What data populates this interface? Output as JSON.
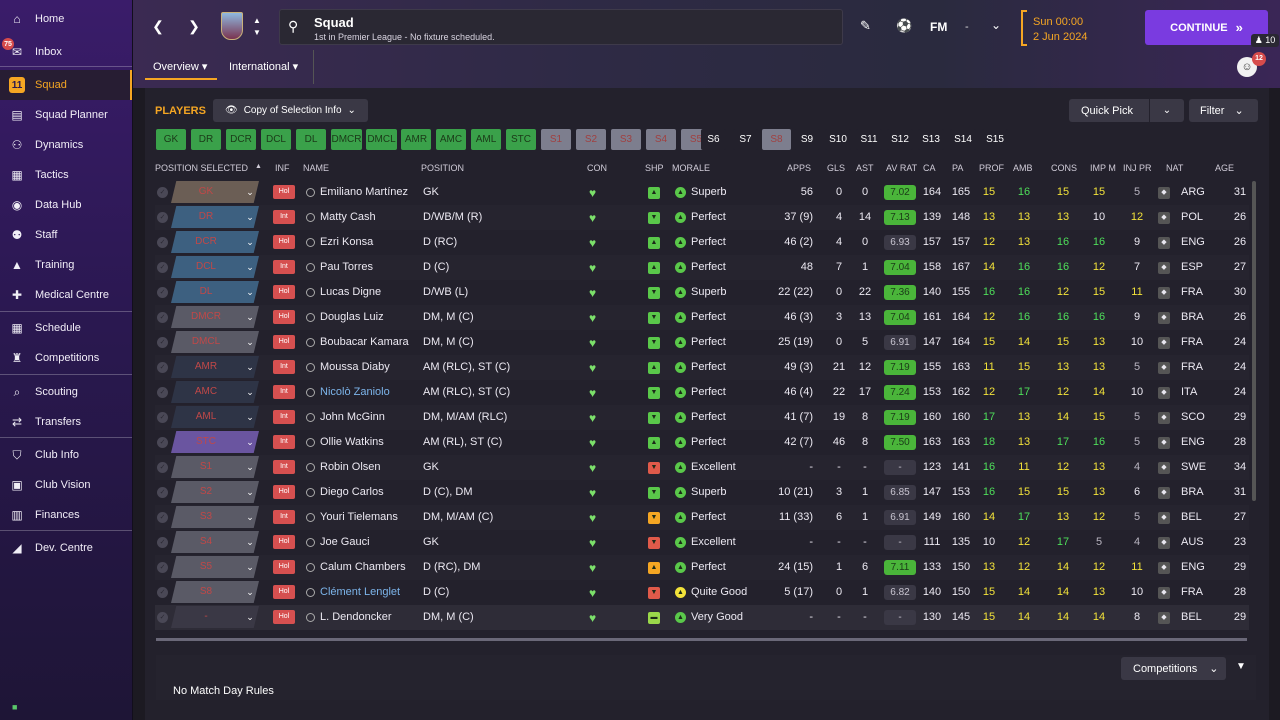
{
  "sidebar": {
    "inbox_badge": "75",
    "items": [
      {
        "label": "Home",
        "icon": "home-icon",
        "glyph": "⌂"
      },
      {
        "label": "Inbox",
        "icon": "inbox-icon",
        "glyph": "✉"
      },
      {
        "label": "Squad",
        "icon": "squad-icon",
        "glyph": "11"
      },
      {
        "label": "Squad Planner",
        "icon": "squad-planner-icon",
        "glyph": "▤"
      },
      {
        "label": "Dynamics",
        "icon": "dynamics-icon",
        "glyph": "⚇"
      },
      {
        "label": "Tactics",
        "icon": "tactics-icon",
        "glyph": "▦"
      },
      {
        "label": "Data Hub",
        "icon": "data-hub-icon",
        "glyph": "◉"
      },
      {
        "label": "Staff",
        "icon": "staff-icon",
        "glyph": "⚉"
      },
      {
        "label": "Training",
        "icon": "training-icon",
        "glyph": "▲"
      },
      {
        "label": "Medical Centre",
        "icon": "medical-icon",
        "glyph": "✚"
      },
      {
        "label": "Schedule",
        "icon": "schedule-icon",
        "glyph": "▦"
      },
      {
        "label": "Competitions",
        "icon": "trophy-icon",
        "glyph": "♜"
      },
      {
        "label": "Scouting",
        "icon": "scouting-icon",
        "glyph": "⌕"
      },
      {
        "label": "Transfers",
        "icon": "transfers-icon",
        "glyph": "⇄"
      },
      {
        "label": "Club Info",
        "icon": "club-info-icon",
        "glyph": "⛉"
      },
      {
        "label": "Club Vision",
        "icon": "club-vision-icon",
        "glyph": "▣"
      },
      {
        "label": "Finances",
        "icon": "finances-icon",
        "glyph": "▥"
      },
      {
        "label": "Dev. Centre",
        "icon": "dev-centre-icon",
        "glyph": "◢"
      }
    ]
  },
  "header": {
    "title": "Squad",
    "subtitle": "1st in Premier League - No fixture scheduled.",
    "fm_label": "FM",
    "fm_dash": "-",
    "date_line1": "Sun 00:00",
    "date_line2": "2 Jun 2024",
    "continue_label": "CONTINUE",
    "inbox_count": "10",
    "notifications": "12",
    "tabs": [
      {
        "label": "Overview ▾"
      },
      {
        "label": "International ▾"
      }
    ]
  },
  "panel": {
    "players_label": "PLAYERS",
    "selection_info": "Copy of Selection Info",
    "quick_pick": "Quick Pick",
    "filter": "Filter",
    "competitions": "Competitions",
    "no_match_rules": "No Match Day Rules"
  },
  "position_chips": [
    {
      "label": "GK",
      "style": "green"
    },
    {
      "label": "DR",
      "style": "green"
    },
    {
      "label": "DCR",
      "style": "green"
    },
    {
      "label": "DCL",
      "style": "green"
    },
    {
      "label": "DL",
      "style": "green"
    },
    {
      "label": "DMCR",
      "style": "green"
    },
    {
      "label": "DMCL",
      "style": "green"
    },
    {
      "label": "AMR",
      "style": "green"
    },
    {
      "label": "AMC",
      "style": "green"
    },
    {
      "label": "AML",
      "style": "green"
    },
    {
      "label": "STC",
      "style": "green"
    },
    {
      "label": "S1",
      "style": "gray"
    },
    {
      "label": "S2",
      "style": "gray"
    },
    {
      "label": "S3",
      "style": "gray"
    },
    {
      "label": "S4",
      "style": "gray"
    },
    {
      "label": "S5",
      "style": "gray"
    },
    {
      "label": "S6",
      "style": "dark"
    },
    {
      "label": "S7",
      "style": "dark"
    },
    {
      "label": "S8",
      "style": "gray"
    },
    {
      "label": "S9",
      "style": "dark"
    },
    {
      "label": "S10",
      "style": "dark"
    },
    {
      "label": "S11",
      "style": "dark"
    },
    {
      "label": "S12",
      "style": "dark"
    },
    {
      "label": "S13",
      "style": "dark"
    },
    {
      "label": "S14",
      "style": "dark"
    },
    {
      "label": "S15",
      "style": "dark"
    }
  ],
  "columns": [
    "POSITION SELECTED",
    "INF",
    "NAME",
    "POSITION",
    "CON",
    "SHP",
    "MORALE",
    "APPS",
    "GLS",
    "AST",
    "AV RAT",
    "CA",
    "PA",
    "PROF",
    "AMB",
    "CONS",
    "IMP M",
    "INJ PR",
    "NAT",
    "AGE"
  ],
  "players": [
    {
      "sel": "GK",
      "dd": "#6b5e55",
      "inf": "Hol",
      "name": "Emiliano Martínez",
      "pos": "GK",
      "shp": "up",
      "shpc": "#5ac84a",
      "mor": "Superb",
      "moric": "#5ac84a",
      "apps": "56",
      "gls": "0",
      "ast": "0",
      "avr": "7.02",
      "avrg": true,
      "ca": "164",
      "pa": "165",
      "prof": "15",
      "profc": "y",
      "amb": "16",
      "ambc": "gr",
      "cons": "15",
      "consc": "y",
      "imp": "15",
      "impc": "y",
      "inj": "5",
      "injc": "gy",
      "nat": "ARG",
      "age": "31",
      "link": false
    },
    {
      "sel": "DR",
      "dd": "#3d6080",
      "inf": "Int",
      "name": "Matty Cash",
      "pos": "D/WB/M (R)",
      "shp": "down",
      "shpc": "#5ac84a",
      "mor": "Perfect",
      "moric": "#5ac84a",
      "apps": "37 (9)",
      "gls": "4",
      "ast": "14",
      "avr": "7.13",
      "avrg": true,
      "ca": "139",
      "pa": "148",
      "prof": "13",
      "profc": "y",
      "amb": "13",
      "ambc": "y",
      "cons": "13",
      "consc": "y",
      "imp": "10",
      "impc": "w",
      "inj": "12",
      "injc": "y",
      "nat": "POL",
      "age": "26",
      "link": false
    },
    {
      "sel": "DCR",
      "dd": "#3d6080",
      "inf": "Hol",
      "name": "Ezri Konsa",
      "pos": "D (RC)",
      "shp": "up",
      "shpc": "#5ac84a",
      "mor": "Perfect",
      "moric": "#5ac84a",
      "apps": "46 (2)",
      "gls": "4",
      "ast": "0",
      "avr": "6.93",
      "avrg": false,
      "ca": "157",
      "pa": "157",
      "prof": "12",
      "profc": "y",
      "amb": "13",
      "ambc": "y",
      "cons": "16",
      "consc": "gr",
      "imp": "16",
      "impc": "gr",
      "inj": "9",
      "injc": "w",
      "nat": "ENG",
      "age": "26",
      "link": false
    },
    {
      "sel": "DCL",
      "dd": "#3d6080",
      "inf": "Int",
      "name": "Pau Torres",
      "pos": "D (C)",
      "shp": "up",
      "shpc": "#5ac84a",
      "mor": "Perfect",
      "moric": "#5ac84a",
      "apps": "48",
      "gls": "7",
      "ast": "1",
      "avr": "7.04",
      "avrg": true,
      "ca": "158",
      "pa": "167",
      "prof": "14",
      "profc": "y",
      "amb": "16",
      "ambc": "gr",
      "cons": "16",
      "consc": "gr",
      "imp": "12",
      "impc": "y",
      "inj": "7",
      "injc": "w",
      "nat": "ESP",
      "age": "27",
      "link": false
    },
    {
      "sel": "DL",
      "dd": "#3d6080",
      "inf": "Hol",
      "name": "Lucas Digne",
      "pos": "D/WB (L)",
      "shp": "down",
      "shpc": "#5ac84a",
      "mor": "Superb",
      "moric": "#5ac84a",
      "apps": "22 (22)",
      "gls": "0",
      "ast": "22",
      "avr": "7.36",
      "avrg": true,
      "ca": "140",
      "pa": "155",
      "prof": "16",
      "profc": "gr",
      "amb": "16",
      "ambc": "gr",
      "cons": "12",
      "consc": "y",
      "imp": "15",
      "impc": "y",
      "inj": "11",
      "injc": "y",
      "nat": "FRA",
      "age": "30",
      "link": false
    },
    {
      "sel": "DMCR",
      "dd": "#5a5a66",
      "inf": "Hol",
      "name": "Douglas Luiz",
      "pos": "DM, M (C)",
      "shp": "down",
      "shpc": "#5ac84a",
      "mor": "Perfect",
      "moric": "#5ac84a",
      "apps": "46 (3)",
      "gls": "3",
      "ast": "13",
      "avr": "7.04",
      "avrg": true,
      "ca": "161",
      "pa": "164",
      "prof": "12",
      "profc": "y",
      "amb": "16",
      "ambc": "gr",
      "cons": "16",
      "consc": "gr",
      "imp": "16",
      "impc": "gr",
      "inj": "9",
      "injc": "w",
      "nat": "BRA",
      "age": "26",
      "link": false
    },
    {
      "sel": "DMCL",
      "dd": "#5a5a66",
      "inf": "Hol",
      "name": "Boubacar Kamara",
      "pos": "DM, M (C)",
      "shp": "down",
      "shpc": "#5ac84a",
      "mor": "Perfect",
      "moric": "#5ac84a",
      "apps": "25 (19)",
      "gls": "0",
      "ast": "5",
      "avr": "6.91",
      "avrg": false,
      "ca": "147",
      "pa": "164",
      "prof": "15",
      "profc": "y",
      "amb": "14",
      "ambc": "y",
      "cons": "15",
      "consc": "y",
      "imp": "13",
      "impc": "y",
      "inj": "10",
      "injc": "w",
      "nat": "FRA",
      "age": "24",
      "link": false
    },
    {
      "sel": "AMR",
      "dd": "#2e3446",
      "inf": "Int",
      "name": "Moussa Diaby",
      "pos": "AM (RLC), ST (C)",
      "shp": "up",
      "shpc": "#5ac84a",
      "mor": "Perfect",
      "moric": "#5ac84a",
      "apps": "49 (3)",
      "gls": "21",
      "ast": "12",
      "avr": "7.19",
      "avrg": true,
      "ca": "155",
      "pa": "163",
      "prof": "11",
      "profc": "y",
      "amb": "15",
      "ambc": "y",
      "cons": "13",
      "consc": "y",
      "imp": "13",
      "impc": "y",
      "inj": "5",
      "injc": "gy",
      "nat": "FRA",
      "age": "24",
      "link": false
    },
    {
      "sel": "AMC",
      "dd": "#2e3446",
      "inf": "Int",
      "name": "Nicolò Zaniolo",
      "pos": "AM (RLC), ST (C)",
      "shp": "down",
      "shpc": "#5ac84a",
      "mor": "Perfect",
      "moric": "#5ac84a",
      "apps": "46 (4)",
      "gls": "22",
      "ast": "17",
      "avr": "7.24",
      "avrg": true,
      "ca": "153",
      "pa": "162",
      "prof": "12",
      "profc": "y",
      "amb": "17",
      "ambc": "gr",
      "cons": "12",
      "consc": "y",
      "imp": "14",
      "impc": "y",
      "inj": "10",
      "injc": "w",
      "nat": "ITA",
      "age": "24",
      "link": true
    },
    {
      "sel": "AML",
      "dd": "#2e3446",
      "inf": "Int",
      "name": "John McGinn",
      "pos": "DM, M/AM (RLC)",
      "shp": "down",
      "shpc": "#5ac84a",
      "mor": "Perfect",
      "moric": "#5ac84a",
      "apps": "41 (7)",
      "gls": "19",
      "ast": "8",
      "avr": "7.19",
      "avrg": true,
      "ca": "160",
      "pa": "160",
      "prof": "17",
      "profc": "gr",
      "amb": "13",
      "ambc": "y",
      "cons": "14",
      "consc": "y",
      "imp": "15",
      "impc": "y",
      "inj": "5",
      "injc": "gy",
      "nat": "SCO",
      "age": "29",
      "link": false
    },
    {
      "sel": "STC",
      "dd": "#6a55a0",
      "inf": "Int",
      "name": "Ollie Watkins",
      "pos": "AM (RL), ST (C)",
      "shp": "up2",
      "shpc": "#5ac84a",
      "mor": "Perfect",
      "moric": "#5ac84a",
      "apps": "42 (7)",
      "gls": "46",
      "ast": "8",
      "avr": "7.50",
      "avrg": true,
      "ca": "163",
      "pa": "163",
      "prof": "18",
      "profc": "gr",
      "amb": "13",
      "ambc": "y",
      "cons": "17",
      "consc": "gr",
      "imp": "16",
      "impc": "gr",
      "inj": "5",
      "injc": "gy",
      "nat": "ENG",
      "age": "28",
      "link": false
    },
    {
      "sel": "S1",
      "dd": "#5a5a66",
      "inf": "Int",
      "name": "Robin Olsen",
      "pos": "GK",
      "shp": "down",
      "shpc": "#e05a4a",
      "mor": "Excellent",
      "moric": "#5ac84a",
      "apps": "-",
      "gls": "-",
      "ast": "-",
      "avr": "-",
      "avrg": false,
      "ca": "123",
      "pa": "141",
      "prof": "16",
      "profc": "gr",
      "amb": "11",
      "ambc": "y",
      "cons": "12",
      "consc": "y",
      "imp": "13",
      "impc": "y",
      "inj": "4",
      "injc": "gy",
      "nat": "SWE",
      "age": "34",
      "link": false
    },
    {
      "sel": "S2",
      "dd": "#5a5a66",
      "inf": "Hol",
      "name": "Diego Carlos",
      "pos": "D (C), DM",
      "shp": "down",
      "shpc": "#5ac84a",
      "mor": "Superb",
      "moric": "#5ac84a",
      "apps": "10 (21)",
      "gls": "3",
      "ast": "1",
      "avr": "6.85",
      "avrg": false,
      "ca": "147",
      "pa": "153",
      "prof": "16",
      "profc": "gr",
      "amb": "15",
      "ambc": "y",
      "cons": "15",
      "consc": "y",
      "imp": "13",
      "impc": "y",
      "inj": "6",
      "injc": "w",
      "nat": "BRA",
      "age": "31",
      "link": false
    },
    {
      "sel": "S3",
      "dd": "#5a5a66",
      "inf": "Int",
      "name": "Youri Tielemans",
      "pos": "DM, M/AM (C)",
      "shp": "down",
      "shpc": "#f5a623",
      "mor": "Perfect",
      "moric": "#5ac84a",
      "apps": "11 (33)",
      "gls": "6",
      "ast": "1",
      "avr": "6.91",
      "avrg": false,
      "ca": "149",
      "pa": "160",
      "prof": "14",
      "profc": "y",
      "amb": "17",
      "ambc": "gr",
      "cons": "13",
      "consc": "y",
      "imp": "12",
      "impc": "y",
      "inj": "5",
      "injc": "gy",
      "nat": "BEL",
      "age": "27",
      "link": false
    },
    {
      "sel": "S4",
      "dd": "#5a5a66",
      "inf": "Hol",
      "name": "Joe Gauci",
      "pos": "GK",
      "shp": "down",
      "shpc": "#e05a4a",
      "mor": "Excellent",
      "moric": "#5ac84a",
      "apps": "-",
      "gls": "-",
      "ast": "-",
      "avr": "-",
      "avrg": false,
      "ca": "111",
      "pa": "135",
      "prof": "10",
      "profc": "w",
      "amb": "12",
      "ambc": "y",
      "cons": "17",
      "consc": "gr",
      "imp": "5",
      "impc": "gy",
      "inj": "4",
      "injc": "gy",
      "nat": "AUS",
      "age": "23",
      "link": false
    },
    {
      "sel": "S5",
      "dd": "#5a5a66",
      "inf": "Hol",
      "name": "Calum Chambers",
      "pos": "D (RC), DM",
      "shp": "up",
      "shpc": "#f5a623",
      "mor": "Perfect",
      "moric": "#5ac84a",
      "apps": "24 (15)",
      "gls": "1",
      "ast": "6",
      "avr": "7.11",
      "avrg": true,
      "ca": "133",
      "pa": "150",
      "prof": "13",
      "profc": "y",
      "amb": "12",
      "ambc": "y",
      "cons": "14",
      "consc": "y",
      "imp": "12",
      "impc": "y",
      "inj": "11",
      "injc": "y",
      "nat": "ENG",
      "age": "29",
      "link": false
    },
    {
      "sel": "S8",
      "dd": "#5a5a66",
      "inf": "Hol",
      "name": "Clément Lenglet",
      "pos": "D (C)",
      "shp": "down",
      "shpc": "#e05a4a",
      "mor": "Quite Good",
      "moric": "#f2e23a",
      "apps": "5 (17)",
      "gls": "0",
      "ast": "1",
      "avr": "6.82",
      "avrg": false,
      "ca": "140",
      "pa": "150",
      "prof": "15",
      "profc": "y",
      "amb": "14",
      "ambc": "y",
      "cons": "14",
      "consc": "y",
      "imp": "13",
      "impc": "y",
      "inj": "10",
      "injc": "w",
      "nat": "FRA",
      "age": "28",
      "link": true
    },
    {
      "sel": "-",
      "dd": "#3a3845",
      "inf": "Hol",
      "name": "L. Dendoncker",
      "pos": "DM, M (C)",
      "shp": "flat",
      "shpc": "#9ad84a",
      "mor": "Very Good",
      "moric": "#5ac84a",
      "apps": "-",
      "gls": "-",
      "ast": "-",
      "avr": "-",
      "avrg": false,
      "ca": "130",
      "pa": "145",
      "prof": "15",
      "profc": "y",
      "amb": "14",
      "ambc": "y",
      "cons": "14",
      "consc": "y",
      "imp": "14",
      "impc": "y",
      "inj": "8",
      "injc": "w",
      "nat": "BEL",
      "age": "29",
      "link": false
    }
  ]
}
